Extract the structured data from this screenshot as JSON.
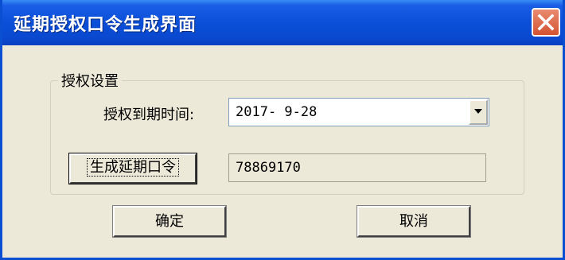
{
  "window": {
    "title": "延期授权口令生成界面"
  },
  "icons": {
    "close": "close-icon",
    "dropdown": "chevron-down-icon"
  },
  "colors": {
    "titlebar": "#0a4fd1",
    "close_button": "#d35331",
    "dialog_background": "#ece9d8"
  },
  "auth_settings": {
    "group_label": "授权设置",
    "expiry_label": "授权到期时间:",
    "expiry_value": "2017- 9-28",
    "generate_button_label": "生成延期口令",
    "token_value": "78869170"
  },
  "footer": {
    "ok_label": "确定",
    "cancel_label": "取消"
  }
}
